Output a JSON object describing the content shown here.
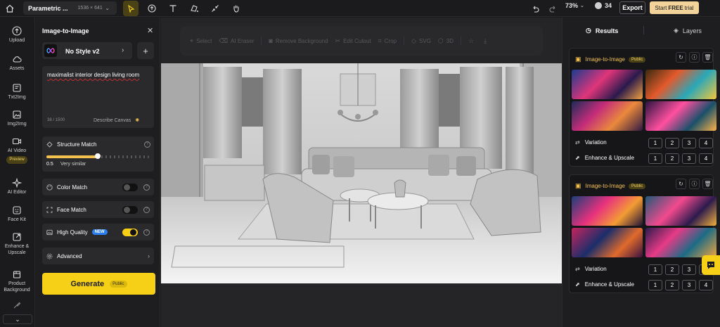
{
  "topbar": {
    "project_name": "Parametric ...",
    "project_dims": "1536 × 641",
    "zoom": "73%",
    "credits": "34",
    "export_label": "Export",
    "trial_prefix": "Start",
    "trial_bold": "FREE",
    "trial_suffix": "trial"
  },
  "rail": {
    "upload": "Upload",
    "assets": "Assets",
    "txt2img": "Txt2Img",
    "img2img": "Img2Img",
    "ai_video": "AI Video",
    "preview": "Preview",
    "ai_editor": "AI Editor",
    "face_kit": "Face Kit",
    "enhance": "Enhance &",
    "upscale": "Upscale",
    "product": "Product",
    "background": "Background"
  },
  "panel": {
    "title": "Image-to-Image",
    "style_name": "No Style v2",
    "prompt": "maximalist interior design living room",
    "prompt_count": "38 / 1500",
    "describe_label": "Describe Canvas",
    "structure_label": "Structure Match",
    "structure_value": "0.5",
    "structure_caption": "Very similar",
    "structure_fraction": 0.5,
    "color_match_label": "Color Match",
    "face_match_label": "Face Match",
    "high_quality_label": "High Quality",
    "new_badge": "NEW",
    "advanced_label": "Advanced",
    "generate_label": "Generate",
    "generate_badge": "Public"
  },
  "canvas": {
    "tools": [
      "Select",
      "AI Eraser",
      "Remove Background",
      "Edit Cutout",
      "Crop",
      "SVG",
      "3D"
    ]
  },
  "results": {
    "tab_results": "Results",
    "tab_layers": "Layers",
    "cards": [
      {
        "title": "Image-to-Image",
        "badge": "Public",
        "variation_label": "Variation",
        "enhance_label": "Enhance & Upscale",
        "numbers": [
          "1",
          "2",
          "3",
          "4"
        ]
      },
      {
        "title": "Image-to-Image",
        "badge": "Public",
        "variation_label": "Variation",
        "enhance_label": "Enhance & Upscale",
        "numbers": [
          "1",
          "2",
          "3",
          "4"
        ]
      }
    ]
  },
  "colors": {
    "accent": "#f5d017",
    "trial": "#f2d49a",
    "new_badge": "#2d7ff9"
  }
}
